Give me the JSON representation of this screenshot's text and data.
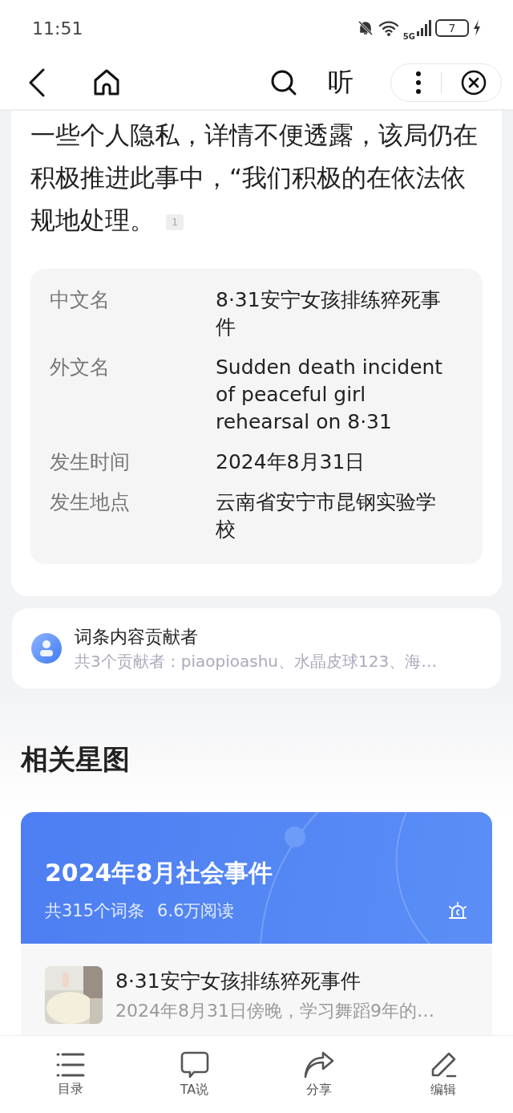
{
  "status_bar": {
    "time": "11:51",
    "network": "5G",
    "battery": "7"
  },
  "nav": {
    "listen": "听"
  },
  "article": {
    "text": "一些个人隐私，详情不便透露，该局仍在积极推进此事中，“我们积极的在依法依规地处理。",
    "footnote": "1"
  },
  "infobox": [
    {
      "label": "中文名",
      "value": "8·31安宁女孩排练猝死事件"
    },
    {
      "label": "外文名",
      "value": "Sudden death incident of peaceful girl rehearsal on 8·31"
    },
    {
      "label": "发生时间",
      "value": "2024年8月31日"
    },
    {
      "label": "发生地点",
      "value": "云南省安宁市昆钢实验学校"
    }
  ],
  "contributors": {
    "title": "词条内容贡献者",
    "summary": "共3个贡献者：piaopioashu、水晶皮球123、海…"
  },
  "related": {
    "heading": "相关星图",
    "card": {
      "title": "2024年8月社会事件",
      "entries": "共315个词条",
      "reads": "6.6万阅读"
    },
    "items": [
      {
        "kind": "picture",
        "title": "8·31安宁女孩排练猝死事件",
        "summary": "2024年8月31日傍晚，学习舞蹈9年的…"
      }
    ]
  },
  "bottom_bar": [
    {
      "kind": "list",
      "label": "目录"
    },
    {
      "kind": "chat",
      "label": "TA说"
    },
    {
      "kind": "share",
      "label": "分享"
    },
    {
      "kind": "edit",
      "label": "编辑"
    }
  ]
}
